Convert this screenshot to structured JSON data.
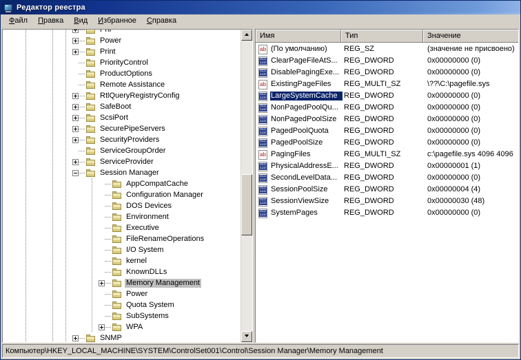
{
  "window": {
    "title": "Редактор реестра",
    "icon": "registry-editor-icon"
  },
  "menubar": {
    "items": [
      {
        "label": "Файл",
        "accel": "Ф"
      },
      {
        "label": "Правка",
        "accel": "П"
      },
      {
        "label": "Вид",
        "accel": "В"
      },
      {
        "label": "Избранное",
        "accel": "И"
      },
      {
        "label": "Справка",
        "accel": "С"
      }
    ]
  },
  "tree": {
    "nodes": [
      {
        "label": "PnP",
        "depth": 0,
        "expander": "plus",
        "selected": false
      },
      {
        "label": "Power",
        "depth": 0,
        "expander": "plus",
        "selected": false
      },
      {
        "label": "Print",
        "depth": 0,
        "expander": "plus",
        "selected": false
      },
      {
        "label": "PriorityControl",
        "depth": 0,
        "expander": "none",
        "selected": false
      },
      {
        "label": "ProductOptions",
        "depth": 0,
        "expander": "none",
        "selected": false
      },
      {
        "label": "Remote Assistance",
        "depth": 0,
        "expander": "none",
        "selected": false
      },
      {
        "label": "RtlQueryRegistryConfig",
        "depth": 0,
        "expander": "plus",
        "selected": false
      },
      {
        "label": "SafeBoot",
        "depth": 0,
        "expander": "plus",
        "selected": false
      },
      {
        "label": "ScsiPort",
        "depth": 0,
        "expander": "plus",
        "selected": false
      },
      {
        "label": "SecurePipeServers",
        "depth": 0,
        "expander": "plus",
        "selected": false
      },
      {
        "label": "SecurityProviders",
        "depth": 0,
        "expander": "plus",
        "selected": false
      },
      {
        "label": "ServiceGroupOrder",
        "depth": 0,
        "expander": "none",
        "selected": false
      },
      {
        "label": "ServiceProvider",
        "depth": 0,
        "expander": "plus",
        "selected": false
      },
      {
        "label": "Session Manager",
        "depth": 0,
        "expander": "minus",
        "selected": false
      },
      {
        "label": "AppCompatCache",
        "depth": 1,
        "expander": "none",
        "selected": false
      },
      {
        "label": "Configuration Manager",
        "depth": 1,
        "expander": "none",
        "selected": false
      },
      {
        "label": "DOS Devices",
        "depth": 1,
        "expander": "none",
        "selected": false
      },
      {
        "label": "Environment",
        "depth": 1,
        "expander": "none",
        "selected": false
      },
      {
        "label": "Executive",
        "depth": 1,
        "expander": "none",
        "selected": false
      },
      {
        "label": "FileRenameOperations",
        "depth": 1,
        "expander": "none",
        "selected": false
      },
      {
        "label": "I/O System",
        "depth": 1,
        "expander": "none",
        "selected": false
      },
      {
        "label": "kernel",
        "depth": 1,
        "expander": "none",
        "selected": false
      },
      {
        "label": "KnownDLLs",
        "depth": 1,
        "expander": "none",
        "selected": false
      },
      {
        "label": "Memory Management",
        "depth": 1,
        "expander": "plus",
        "selected": true
      },
      {
        "label": "Power",
        "depth": 1,
        "expander": "none",
        "selected": false
      },
      {
        "label": "Quota System",
        "depth": 1,
        "expander": "none",
        "selected": false
      },
      {
        "label": "SubSystems",
        "depth": 1,
        "expander": "none",
        "selected": false
      },
      {
        "label": "WPA",
        "depth": 1,
        "expander": "plus",
        "selected": false
      },
      {
        "label": "SNMP",
        "depth": 0,
        "expander": "plus",
        "selected": false
      }
    ],
    "scrollbar": {
      "up_arrow": "▲",
      "down_arrow": "▼",
      "thumb_top_pct": 46,
      "thumb_height_pct": 21
    }
  },
  "listview": {
    "columns": [
      {
        "key": "name",
        "label": "Имя"
      },
      {
        "key": "type",
        "label": "Тип"
      },
      {
        "key": "value",
        "label": "Значение"
      }
    ],
    "rows": [
      {
        "icon": "string-value-icon",
        "name": "(По умолчанию)",
        "type": "REG_SZ",
        "value": "(значение не присвоено)",
        "selected": false
      },
      {
        "icon": "binary-value-icon",
        "name": "ClearPageFileAtS...",
        "type": "REG_DWORD",
        "value": "0x00000000 (0)",
        "selected": false
      },
      {
        "icon": "binary-value-icon",
        "name": "DisablePagingExe...",
        "type": "REG_DWORD",
        "value": "0x00000000 (0)",
        "selected": false
      },
      {
        "icon": "string-value-icon",
        "name": "ExistingPageFiles",
        "type": "REG_MULTI_SZ",
        "value": "\\??\\C:\\pagefile.sys",
        "selected": false
      },
      {
        "icon": "binary-value-icon",
        "name": "LargeSystemCache",
        "type": "REG_DWORD",
        "value": "0x00000000 (0)",
        "selected": true
      },
      {
        "icon": "binary-value-icon",
        "name": "NonPagedPoolQu...",
        "type": "REG_DWORD",
        "value": "0x00000000 (0)",
        "selected": false
      },
      {
        "icon": "binary-value-icon",
        "name": "NonPagedPoolSize",
        "type": "REG_DWORD",
        "value": "0x00000000 (0)",
        "selected": false
      },
      {
        "icon": "binary-value-icon",
        "name": "PagedPoolQuota",
        "type": "REG_DWORD",
        "value": "0x00000000 (0)",
        "selected": false
      },
      {
        "icon": "binary-value-icon",
        "name": "PagedPoolSize",
        "type": "REG_DWORD",
        "value": "0x00000000 (0)",
        "selected": false
      },
      {
        "icon": "string-value-icon",
        "name": "PagingFiles",
        "type": "REG_MULTI_SZ",
        "value": "c:\\pagefile.sys 4096 4096",
        "selected": false
      },
      {
        "icon": "binary-value-icon",
        "name": "PhysicalAddressE...",
        "type": "REG_DWORD",
        "value": "0x00000001 (1)",
        "selected": false
      },
      {
        "icon": "binary-value-icon",
        "name": "SecondLevelData...",
        "type": "REG_DWORD",
        "value": "0x00000000 (0)",
        "selected": false
      },
      {
        "icon": "binary-value-icon",
        "name": "SessionPoolSize",
        "type": "REG_DWORD",
        "value": "0x00000004 (4)",
        "selected": false
      },
      {
        "icon": "binary-value-icon",
        "name": "SessionViewSize",
        "type": "REG_DWORD",
        "value": "0x00000030 (48)",
        "selected": false
      },
      {
        "icon": "binary-value-icon",
        "name": "SystemPages",
        "type": "REG_DWORD",
        "value": "0x00000000 (0)",
        "selected": false
      }
    ]
  },
  "statusbar": {
    "path": "Компьютер\\HKEY_LOCAL_MACHINE\\SYSTEM\\ControlSet001\\Control\\Session Manager\\Memory Management"
  },
  "colors": {
    "title_gradient_start": "#0a246a",
    "title_gradient_end": "#8fb2e5",
    "face": "#d4d0c8",
    "selection": "#0a246a",
    "tree_selection": "#c0c0c0",
    "folder": "#e6d98f"
  }
}
